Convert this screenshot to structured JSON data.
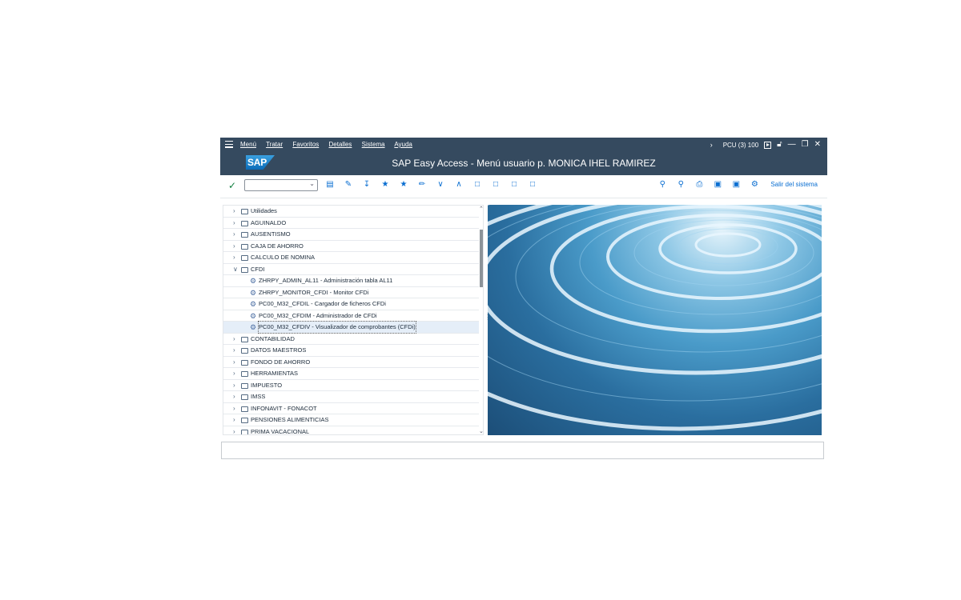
{
  "menubar": {
    "items": [
      "Menú",
      "Tratar",
      "Favoritos",
      "Detalles",
      "Sistema",
      "Ayuda"
    ],
    "system": "PCU (3) 100"
  },
  "title": "SAP Easy Access  -  Menú usuario p. MONICA IHEL RAMIREZ",
  "logo": "SAP",
  "toolbar": {
    "logoff_label": "Salir del sistema",
    "command_value": ""
  },
  "tree": [
    {
      "label": "Utilidades"
    },
    {
      "label": "AGUINALDO"
    },
    {
      "label": "AUSENTISMO"
    },
    {
      "label": "CAJA DE AHORRO"
    },
    {
      "label": "CALCULO DE NOMINA"
    },
    {
      "label": "CFDI",
      "expanded": true
    },
    {
      "label": "ZHRPY_ADMIN_AL11 - Administración tabla AL11",
      "child": true
    },
    {
      "label": "ZHRPY_MONITOR_CFDI - Monitor CFDi",
      "child": true
    },
    {
      "label": "PC00_M32_CFDIL - Cargador de ficheros CFDi",
      "child": true
    },
    {
      "label": "PC00_M32_CFDIM - Administrador de CFDi",
      "child": true
    },
    {
      "label": "PC00_M32_CFDIV - Visualizador de comprobantes (CFDi)",
      "child": true,
      "selected": true
    },
    {
      "label": "CONTABILIDAD"
    },
    {
      "label": "DATOS MAESTROS"
    },
    {
      "label": "FONDO DE AHORRO"
    },
    {
      "label": "HERRAMIENTAS"
    },
    {
      "label": "IMPUESTO"
    },
    {
      "label": "IMSS"
    },
    {
      "label": "INFONAVIT - FONACOT"
    },
    {
      "label": "PENSIONES ALIMENTICIAS"
    },
    {
      "label": "PRIMA VACACIONAL"
    }
  ],
  "colors": {
    "shell": "#354a5f",
    "accent": "#0a6ed1",
    "ok": "#107e3e"
  },
  "statusbar": {
    "text": ""
  }
}
